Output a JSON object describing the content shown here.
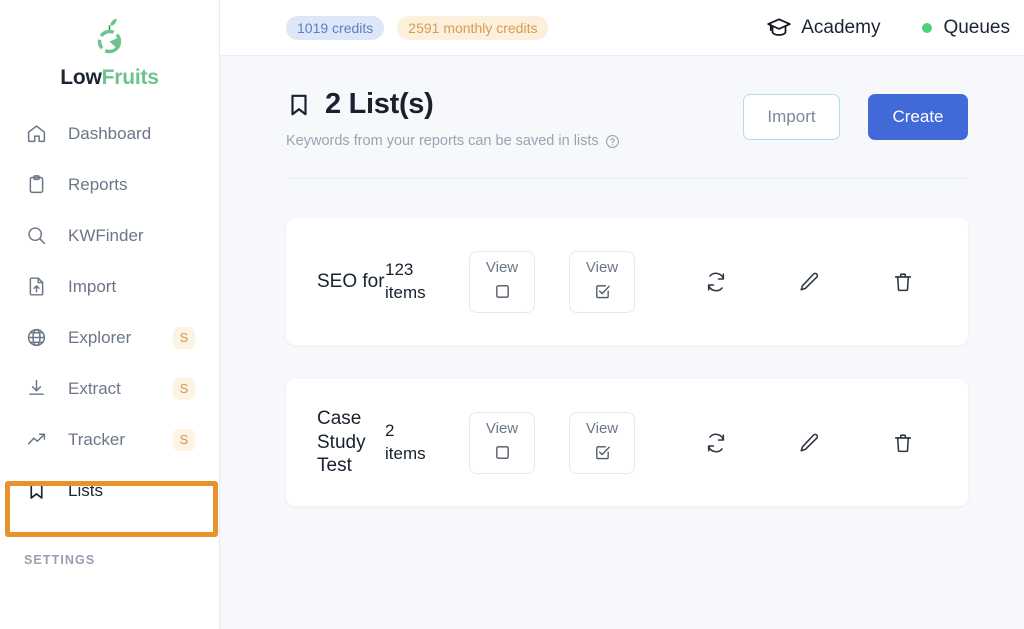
{
  "brand": {
    "name_prefix": "Low",
    "name_suffix": "Fruits",
    "logo_icon": "fruit-logo-icon",
    "accent_green": "#6bc48e"
  },
  "sidebar": {
    "items": [
      {
        "label": "Dashboard",
        "icon": "home-icon",
        "badge": "",
        "active": false
      },
      {
        "label": "Reports",
        "icon": "clipboard-icon",
        "badge": "",
        "active": false
      },
      {
        "label": "KWFinder",
        "icon": "search-icon",
        "badge": "",
        "active": false
      },
      {
        "label": "Import",
        "icon": "file-upload-icon",
        "badge": "",
        "active": false
      },
      {
        "label": "Explorer",
        "icon": "globe-icon",
        "badge": "S",
        "active": false
      },
      {
        "label": "Extract",
        "icon": "download-icon",
        "badge": "S",
        "active": false
      },
      {
        "label": "Tracker",
        "icon": "trend-up-icon",
        "badge": "S",
        "active": false
      },
      {
        "label": "Lists",
        "icon": "bookmark-icon",
        "badge": "",
        "active": true
      }
    ],
    "section_label": "SETTINGS",
    "highlight_color": "#e8922e",
    "badge_bg": "#fdf3e2",
    "badge_color": "#c99a52"
  },
  "topbar": {
    "credits": {
      "label": "1019 credits",
      "bg": "#dde7f8",
      "color": "#5b7fc4"
    },
    "monthly_credits": {
      "label": "2591 monthly credits",
      "bg": "#fcf0dd",
      "color": "#d69d4e"
    },
    "academy": {
      "label": "Academy",
      "icon": "graduation-cap-icon"
    },
    "queues": {
      "label": "Queues",
      "icon": "status-dot-icon",
      "dot_color": "#4ed07a"
    }
  },
  "page": {
    "title": "2 List(s)",
    "title_icon": "bookmark-icon",
    "subtitle": "Keywords from your reports can be saved in lists",
    "help_icon": "help-circle-icon",
    "import_button": "Import",
    "create_button": "Create",
    "create_color": "#4169d8"
  },
  "lists": [
    {
      "name": "SEO for",
      "count": "123",
      "count_unit": "items",
      "view_unchecked_label": "View",
      "view_checked_label": "View",
      "actions": [
        "refresh-icon",
        "edit-icon",
        "delete-icon"
      ]
    },
    {
      "name": "Case Study Test",
      "count": "2",
      "count_unit": "items",
      "view_unchecked_label": "View",
      "view_checked_label": "View",
      "actions": [
        "refresh-icon",
        "edit-icon",
        "delete-icon"
      ]
    }
  ]
}
